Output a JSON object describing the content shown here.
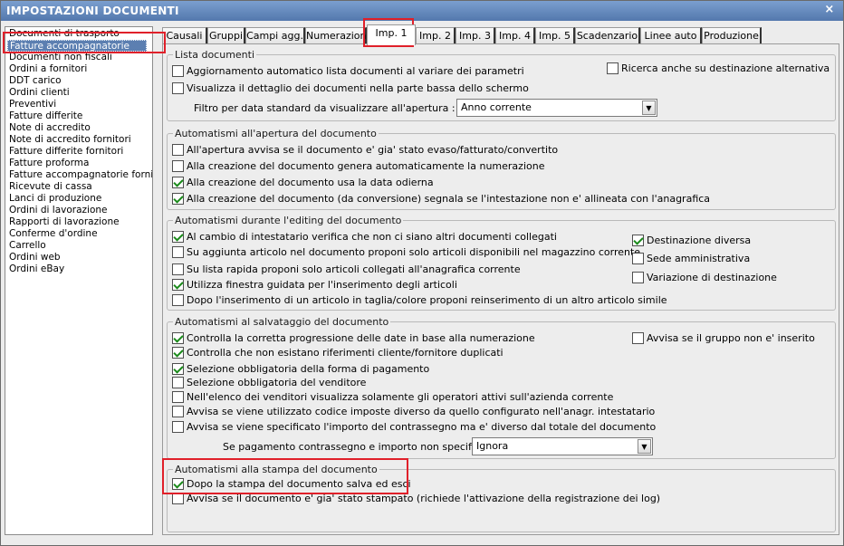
{
  "window": {
    "title": "IMPOSTAZIONI DOCUMENTI",
    "close_icon": "×"
  },
  "sidebar": {
    "items": [
      {
        "label": "Documenti di trasporto"
      },
      {
        "label": "Fatture accompagnatorie"
      },
      {
        "label": "Documenti non fiscali"
      },
      {
        "label": "Ordini a fornitori"
      },
      {
        "label": "DDT carico"
      },
      {
        "label": "Ordini clienti"
      },
      {
        "label": "Preventivi"
      },
      {
        "label": "Fatture differite"
      },
      {
        "label": "Note di accredito"
      },
      {
        "label": "Note di accredito fornitori"
      },
      {
        "label": "Fatture differite fornitori"
      },
      {
        "label": "Fatture proforma"
      },
      {
        "label": "Fatture accompagnatorie fornito"
      },
      {
        "label": "Ricevute di cassa"
      },
      {
        "label": "Lanci di produzione"
      },
      {
        "label": "Ordini di lavorazione"
      },
      {
        "label": "Rapporti di lavorazione"
      },
      {
        "label": "Conferme d'ordine"
      },
      {
        "label": "Carrello"
      },
      {
        "label": "Ordini web"
      },
      {
        "label": "Ordini eBay"
      }
    ],
    "selected_index": 1
  },
  "tabs": [
    {
      "label": "Causali"
    },
    {
      "label": "Gruppi"
    },
    {
      "label": "Campi agg."
    },
    {
      "label": "Numerazioni"
    },
    {
      "label": "Imp. 1"
    },
    {
      "label": "Imp. 2"
    },
    {
      "label": "Imp. 3"
    },
    {
      "label": "Imp. 4"
    },
    {
      "label": "Imp. 5"
    },
    {
      "label": "Scadenzario"
    },
    {
      "label": "Linee auto"
    },
    {
      "label": "Produzione"
    }
  ],
  "active_tab": "Imp. 1",
  "lista": {
    "legend": "Lista documenti",
    "opt1": {
      "label": "Aggiornamento automatico lista documenti al variare dei parametri",
      "checked": false
    },
    "opt2": {
      "label": "Visualizza il dettaglio dei documenti nella parte bassa dello schermo",
      "checked": false
    },
    "opt3": {
      "label": "Ricerca anche su destinazione alternativa",
      "checked": false
    },
    "filter_label": "Filtro per data standard da visualizzare all'apertura :",
    "filter_value": "Anno corrente"
  },
  "apertura": {
    "legend": "Automatismi all'apertura del documento",
    "opt1": {
      "label": "All'apertura avvisa se il documento e' gia' stato evaso/fatturato/convertito",
      "checked": false
    },
    "opt2": {
      "label": "Alla creazione del documento genera automaticamente la numerazione",
      "checked": false
    },
    "opt3": {
      "label": "Alla creazione del documento usa la data odierna",
      "checked": true
    },
    "opt4": {
      "label": "Alla creazione del documento (da conversione) segnala se l'intestazione non e' allineata con l'anagrafica",
      "checked": true
    }
  },
  "editing": {
    "legend": "Automatismi durante l'editing del documento",
    "opt1": {
      "label": "Al cambio di intestatario verifica che non ci siano altri documenti collegati",
      "checked": true
    },
    "opt2": {
      "label": "Su aggiunta articolo nel documento proponi solo articoli disponibili nel magazzino corrente",
      "checked": false
    },
    "opt3": {
      "label": "Su lista rapida proponi solo articoli collegati all'anagrafica corrente",
      "checked": false
    },
    "opt4": {
      "label": "Utilizza finestra guidata per l'inserimento degli articoli",
      "checked": true
    },
    "opt5": {
      "label": "Dopo l'inserimento di un articolo in taglia/colore proponi reinserimento di un altro articolo simile",
      "checked": false
    },
    "opt6": {
      "label": "Destinazione diversa",
      "checked": true
    },
    "opt7": {
      "label": "Sede amministrativa",
      "checked": false
    },
    "opt8": {
      "label": "Variazione di destinazione",
      "checked": false
    }
  },
  "salvataggio": {
    "legend": "Automatismi al salvataggio del documento",
    "opt1": {
      "label": "Controlla la corretta progressione delle date in base alla numerazione",
      "checked": true
    },
    "opt2": {
      "label": "Controlla che non esistano riferimenti cliente/fornitore duplicati",
      "checked": true
    },
    "opt3": {
      "label": "Selezione obbligatoria della forma di pagamento",
      "checked": true
    },
    "opt4": {
      "label": "Selezione obbligatoria del venditore",
      "checked": false
    },
    "opt5": {
      "label": "Nell'elenco dei venditori visualizza solamente gli operatori attivi sull'azienda corrente",
      "checked": false
    },
    "opt6": {
      "label": "Avvisa se viene utilizzato codice imposte diverso da quello configurato nell'anagr. intestatario",
      "checked": false
    },
    "opt7": {
      "label": "Avvisa se viene specificato l'importo del contrassegno ma e' diverso dal totale del documento",
      "checked": false
    },
    "opt8": {
      "label": "Avvisa se il gruppo non e' inserito",
      "checked": false
    },
    "pay_label": "Se pagamento contrassegno e importo non specificato :",
    "pay_value": "Ignora"
  },
  "stampa": {
    "legend": "Automatismi alla stampa del documento",
    "opt1": {
      "label": "Dopo la stampa del documento salva ed esci",
      "checked": true
    },
    "opt2": {
      "label": "Avvisa se il documento e' gia' stato stampato (richiede l'attivazione della registrazione dei log)",
      "checked": false
    }
  },
  "colors": {
    "title_bar": "#5b80b4",
    "highlight": "#e0202a",
    "check": "#1a8a1a"
  }
}
